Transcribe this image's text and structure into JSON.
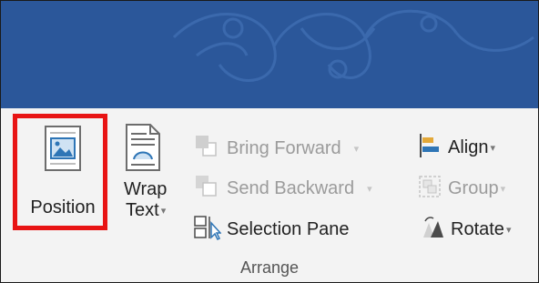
{
  "ribbon": {
    "group_label": "Arrange",
    "buttons": {
      "position": "Position",
      "wrap_text_line1": "Wrap",
      "wrap_text_line2": "Text",
      "bring_forward": "Bring Forward",
      "send_backward": "Send Backward",
      "selection_pane": "Selection Pane",
      "align": "Align",
      "group": "Group",
      "rotate": "Rotate"
    },
    "dropdown_glyph": "▾"
  },
  "colors": {
    "banner": "#2b579a",
    "highlight": "#e81414",
    "ribbon_bg": "#f3f3f3"
  }
}
